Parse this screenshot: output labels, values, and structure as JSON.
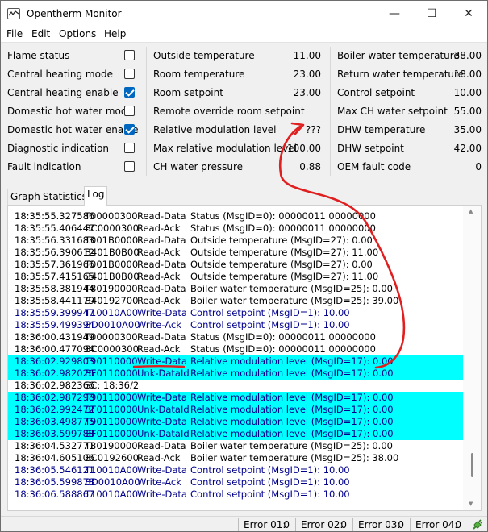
{
  "window": {
    "title": "Opentherm Monitor"
  },
  "menu": [
    "File",
    "Edit",
    "Options",
    "Help"
  ],
  "flags": [
    {
      "label": "Flame status",
      "checked": false
    },
    {
      "label": "Central heating mode",
      "checked": false
    },
    {
      "label": "Central heating enable",
      "checked": true
    },
    {
      "label": "Domestic hot water mode",
      "checked": false
    },
    {
      "label": "Domestic hot water enable",
      "checked": true
    },
    {
      "label": "Diagnostic indication",
      "checked": false
    },
    {
      "label": "Fault indication",
      "checked": false
    }
  ],
  "middle_values": [
    {
      "label": "Outside temperature",
      "value": "11.00"
    },
    {
      "label": "Room temperature",
      "value": "23.00"
    },
    {
      "label": "Room setpoint",
      "value": "23.00"
    },
    {
      "label": "Remote override room setpoint",
      "value": ""
    },
    {
      "label": "Relative modulation level",
      "value": "???"
    },
    {
      "label": "Max relative modulation level",
      "value": "100.00"
    },
    {
      "label": "CH water pressure",
      "value": "0.88"
    }
  ],
  "right_values": [
    {
      "label": "Boiler water temperature",
      "value": "38.00"
    },
    {
      "label": "Return water temperature",
      "value": "18.00"
    },
    {
      "label": "Control setpoint",
      "value": "10.00"
    },
    {
      "label": "Max CH water setpoint",
      "value": "55.00"
    },
    {
      "label": "DHW temperature",
      "value": "35.00"
    },
    {
      "label": "DHW setpoint",
      "value": "42.00"
    },
    {
      "label": "OEM fault code",
      "value": "0"
    }
  ],
  "tabs": [
    "Graph",
    "Statistics",
    "Log"
  ],
  "active_tab": "Log",
  "log": [
    {
      "time": "18:35:55.327586",
      "code": "T00000300",
      "type": "Read-Data",
      "desc": "Status (MsgID=0): 00000011 00000000",
      "blue": false,
      "hl": false
    },
    {
      "time": "18:35:55.406447",
      "code": "BC0000300",
      "type": "Read-Ack",
      "desc": "Status (MsgID=0): 00000011 00000000",
      "blue": false,
      "hl": false
    },
    {
      "time": "18:35:56.331683",
      "code": "T001B0000",
      "type": "Read-Data",
      "desc": "Outside temperature (MsgID=27): 0.00",
      "blue": false,
      "hl": false
    },
    {
      "time": "18:35:56.390612",
      "code": "B401B0B00",
      "type": "Read-Ack",
      "desc": "Outside temperature (MsgID=27): 11.00",
      "blue": false,
      "hl": false
    },
    {
      "time": "18:35:57.361966",
      "code": "T001B0000",
      "type": "Read-Data",
      "desc": "Outside temperature (MsgID=27): 0.00",
      "blue": false,
      "hl": false
    },
    {
      "time": "18:35:57.415165",
      "code": "B401B0B00",
      "type": "Read-Ack",
      "desc": "Outside temperature (MsgID=27): 11.00",
      "blue": false,
      "hl": false
    },
    {
      "time": "18:35:58.381944",
      "code": "T80190000",
      "type": "Read-Data",
      "desc": "Boiler water temperature (MsgID=25): 0.00",
      "blue": false,
      "hl": false
    },
    {
      "time": "18:35:58.441179",
      "code": "B40192700",
      "type": "Read-Ack",
      "desc": "Boiler water temperature (MsgID=25): 39.00",
      "blue": false,
      "hl": false
    },
    {
      "time": "18:35:59.399947",
      "code": "T10010A00",
      "type": "Write-Data",
      "desc": "Control setpoint (MsgID=1): 10.00",
      "blue": true,
      "hl": false
    },
    {
      "time": "18:35:59.499394",
      "code": "BD0010A00",
      "type": "Write-Ack",
      "desc": "Control setpoint (MsgID=1): 10.00",
      "blue": true,
      "hl": false
    },
    {
      "time": "18:36:00.431949",
      "code": "T00000300",
      "type": "Read-Data",
      "desc": "Status (MsgID=0): 00000011 00000000",
      "blue": false,
      "hl": false
    },
    {
      "time": "18:36:00.477094",
      "code": "BC0000300",
      "type": "Read-Ack",
      "desc": "Status (MsgID=0): 00000011 00000000",
      "blue": false,
      "hl": false
    },
    {
      "time": "18:36:02.929803",
      "code": "T90110000",
      "type": "Write-Data",
      "desc": "Relative modulation level (MsgID=17): 0.00",
      "blue": true,
      "hl": true
    },
    {
      "time": "18:36:02.982026",
      "code": "BF0110000",
      "type": "Unk-DataId",
      "desc": "Relative modulation level (MsgID=17): 0.00",
      "blue": true,
      "hl": true
    },
    {
      "time": "18:36:02.982366",
      "code": "SC: 18:36/2",
      "type": "",
      "desc": "",
      "blue": false,
      "hl": false
    },
    {
      "time": "18:36:02.987298",
      "code": "T90110000",
      "type": "Write-Data",
      "desc": "Relative modulation level (MsgID=17): 0.00",
      "blue": true,
      "hl": true
    },
    {
      "time": "18:36:02.992472",
      "code": "BF0110000",
      "type": "Unk-DataId",
      "desc": "Relative modulation level (MsgID=17): 0.00",
      "blue": true,
      "hl": true
    },
    {
      "time": "18:36:03.498775",
      "code": "T90110000",
      "type": "Write-Data",
      "desc": "Relative modulation level (MsgID=17): 0.00",
      "blue": true,
      "hl": true
    },
    {
      "time": "18:36:03.599788",
      "code": "BF0110000",
      "type": "Unk-DataId",
      "desc": "Relative modulation level (MsgID=17): 0.00",
      "blue": true,
      "hl": true
    },
    {
      "time": "18:36:04.532771",
      "code": "T80190000",
      "type": "Read-Data",
      "desc": "Boiler water temperature (MsgID=25): 0.00",
      "blue": false,
      "hl": false
    },
    {
      "time": "18:36:04.605106",
      "code": "BC0192600",
      "type": "Read-Ack",
      "desc": "Boiler water temperature (MsgID=25): 38.00",
      "blue": false,
      "hl": false
    },
    {
      "time": "18:36:05.546121",
      "code": "T10010A00",
      "type": "Write-Data",
      "desc": "Control setpoint (MsgID=1): 10.00",
      "blue": true,
      "hl": false
    },
    {
      "time": "18:36:05.599878",
      "code": "BD0010A00",
      "type": "Write-Ack",
      "desc": "Control setpoint (MsgID=1): 10.00",
      "blue": true,
      "hl": false
    },
    {
      "time": "18:36:06.588867",
      "code": "T10010A00",
      "type": "Write-Data",
      "desc": "Control setpoint (MsgID=1): 10.00",
      "blue": true,
      "hl": false
    }
  ],
  "status_bar": [
    {
      "label": "Error 01:",
      "value": "0"
    },
    {
      "label": "Error 02:",
      "value": "0"
    },
    {
      "label": "Error 03:",
      "value": "0"
    },
    {
      "label": "Error 04:",
      "value": "0"
    }
  ],
  "colors": {
    "highlight": "#00ffff",
    "write_text": "#00008b",
    "annotation": "#e02020",
    "checkbox_checked": "#0067c0"
  },
  "icons": {
    "app": "chart-window-icon",
    "connection": "plug-connected-icon"
  }
}
